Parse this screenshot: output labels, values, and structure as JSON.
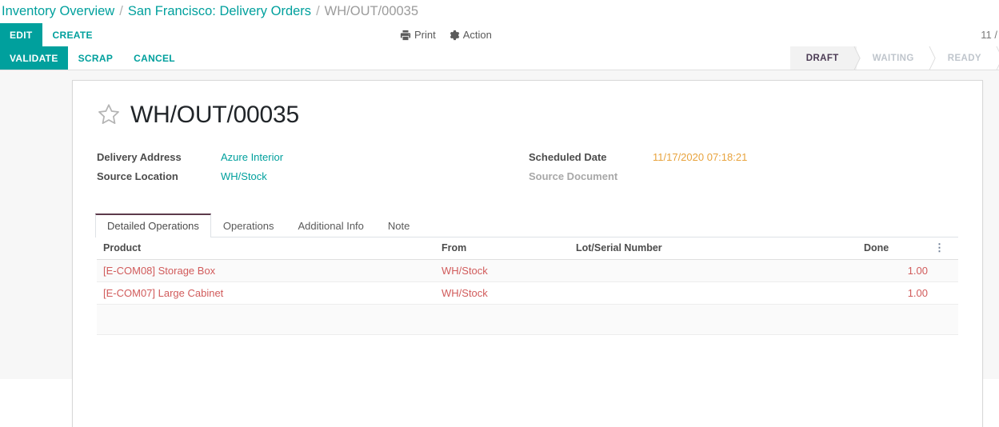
{
  "breadcrumb": {
    "items": [
      {
        "label": "Inventory Overview",
        "active": false
      },
      {
        "label": "San Francisco: Delivery Orders",
        "active": false
      },
      {
        "label": "WH/OUT/00035",
        "active": true
      }
    ],
    "separator": "/"
  },
  "control_panel": {
    "edit_label": "EDIT",
    "create_label": "CREATE",
    "print_label": "Print",
    "action_label": "Action",
    "print_icon": "printer-icon",
    "action_icon": "gear-icon",
    "pager": "11 /"
  },
  "action_bar": {
    "validate_label": "VALIDATE",
    "scrap_label": "SCRAP",
    "cancel_label": "CANCEL"
  },
  "statusbar": {
    "steps": [
      {
        "label": "DRAFT",
        "active": true
      },
      {
        "label": "WAITING",
        "active": false
      },
      {
        "label": "READY",
        "active": false
      }
    ]
  },
  "form": {
    "star_icon": "star-outline-icon",
    "title": "WH/OUT/00035",
    "fields_left": [
      {
        "label": "Delivery Address",
        "value": "Azure Interior",
        "muted": false,
        "kind": "link"
      },
      {
        "label": "Source Location",
        "value": "WH/Stock",
        "muted": false,
        "kind": "link"
      }
    ],
    "fields_right": [
      {
        "label": "Scheduled Date",
        "value": "11/17/2020 07:18:21",
        "muted": false,
        "kind": "date"
      },
      {
        "label": "Source Document",
        "value": "",
        "muted": true,
        "kind": "text"
      }
    ]
  },
  "notebook": {
    "tabs": [
      {
        "label": "Detailed Operations",
        "active": true
      },
      {
        "label": "Operations",
        "active": false
      },
      {
        "label": "Additional Info",
        "active": false
      },
      {
        "label": "Note",
        "active": false
      }
    ]
  },
  "table": {
    "columns": [
      {
        "label": "Product",
        "align": "left"
      },
      {
        "label": "From",
        "align": "left"
      },
      {
        "label": "Lot/Serial Number",
        "align": "left"
      },
      {
        "label": "Done",
        "align": "right"
      }
    ],
    "optional_columns_icon": "vertical-dots-icon",
    "rows": [
      {
        "product": "[E-COM08] Storage Box",
        "from": "WH/Stock",
        "lot": "",
        "done": "1.00"
      },
      {
        "product": "[E-COM07] Large Cabinet",
        "from": "WH/Stock",
        "lot": "",
        "done": "1.00"
      }
    ]
  },
  "colors": {
    "accent_teal": "#00A09D",
    "required_red": "#d15b5b",
    "date_orange": "#e8a33d",
    "active_tab_border": "#5c3a4b",
    "page_bg": "#f7f7f7"
  }
}
